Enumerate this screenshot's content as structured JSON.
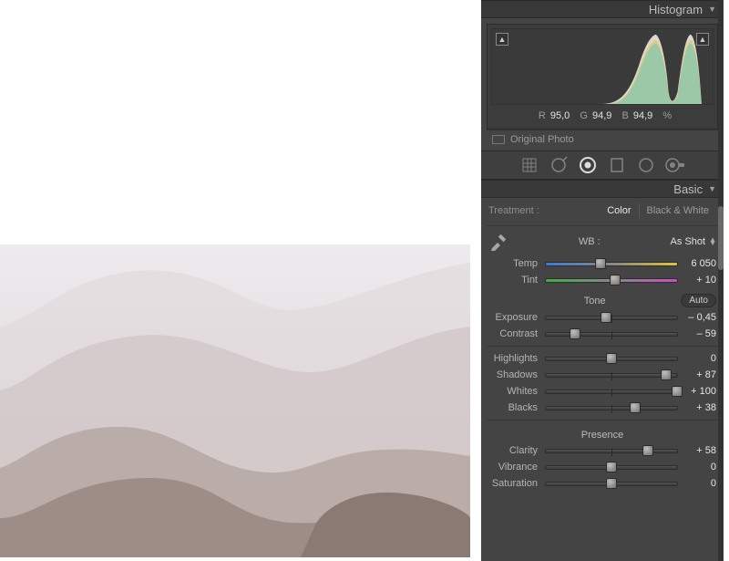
{
  "panel": {
    "histogram": {
      "title": "Histogram",
      "rgb": {
        "r_label": "R",
        "r": "95,0",
        "g_label": "G",
        "g": "94,9",
        "b_label": "B",
        "b": "94,9",
        "unit": "%"
      },
      "original_photo": "Original Photo"
    },
    "basic": {
      "title": "Basic",
      "treatment": {
        "label": "Treatment :",
        "color": "Color",
        "bw": "Black & White"
      },
      "wb": {
        "label": "WB :",
        "value": "As Shot"
      },
      "temp": {
        "label": "Temp",
        "value": "6 050",
        "pos": 42
      },
      "tint": {
        "label": "Tint",
        "value": "+ 10",
        "pos": 53
      },
      "tone_title": "Tone",
      "auto": "Auto",
      "exposure": {
        "label": "Exposure",
        "value": "– 0,45",
        "pos": 46
      },
      "contrast": {
        "label": "Contrast",
        "value": "– 59",
        "pos": 22
      },
      "highlights": {
        "label": "Highlights",
        "value": "0",
        "pos": 50
      },
      "shadows": {
        "label": "Shadows",
        "value": "+ 87",
        "pos": 92
      },
      "whites": {
        "label": "Whites",
        "value": "+ 100",
        "pos": 100
      },
      "blacks": {
        "label": "Blacks",
        "value": "+ 38",
        "pos": 68
      },
      "presence_title": "Presence",
      "clarity": {
        "label": "Clarity",
        "value": "+ 58",
        "pos": 78
      },
      "vibrance": {
        "label": "Vibrance",
        "value": "0",
        "pos": 50
      },
      "saturation": {
        "label": "Saturation",
        "value": "0",
        "pos": 50
      }
    }
  }
}
